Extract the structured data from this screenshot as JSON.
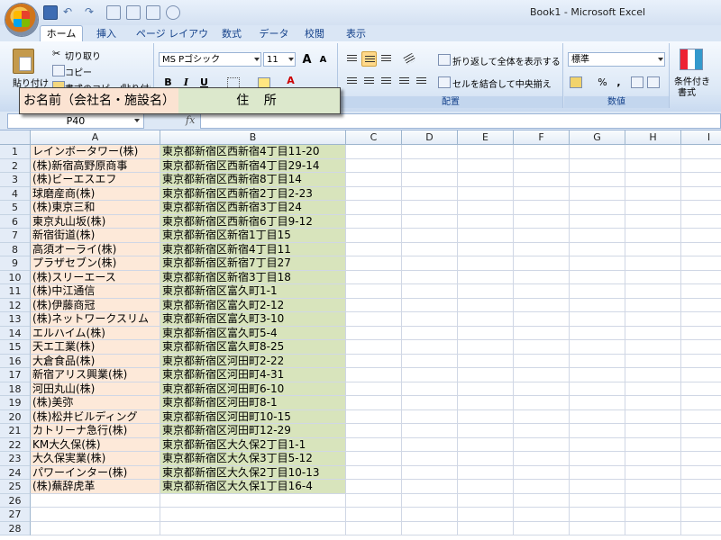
{
  "window": {
    "title": "Book1 - Microsoft Excel"
  },
  "tabs": [
    {
      "label": "ホーム",
      "active": true
    },
    {
      "label": "挿入"
    },
    {
      "label": "ページ レイアウト"
    },
    {
      "label": "数式"
    },
    {
      "label": "データ"
    },
    {
      "label": "校閲"
    },
    {
      "label": "表示"
    }
  ],
  "ribbon": {
    "clipboard": {
      "paste_label": "貼り付け",
      "cut_label": "切り取り",
      "copy_label": "コピー",
      "format_painter_label": "書式のコピー/貼り付け"
    },
    "font": {
      "font_name": "MS Pゴシック",
      "font_size": "11",
      "grow_label": "A",
      "shrink_label": "A",
      "bold": "B",
      "italic": "I",
      "underline": "U",
      "font_color_label": "A"
    },
    "alignment": {
      "wrap_text_label": "折り返して全体を表示する",
      "merge_label": "セルを結合して中央揃え",
      "group_label": "配置"
    },
    "number": {
      "format": "標準",
      "percent": "%",
      "comma": ",",
      "group_label": "数値"
    },
    "styles": {
      "conditional_label": "条件付き",
      "format_label": "書式"
    }
  },
  "callout": {
    "col_a": "お名前（会社名・施設名）",
    "col_b": "住 所"
  },
  "formula_bar": {
    "name_box": "P40",
    "fx": "fx",
    "value": ""
  },
  "grid": {
    "columns": [
      "A",
      "B",
      "C",
      "D",
      "E",
      "F",
      "G",
      "H",
      "I"
    ],
    "rows": [
      {
        "num": "1",
        "a": "レインボータワー(株)",
        "b": "東京都新宿区西新宿4丁目11-20"
      },
      {
        "num": "2",
        "a": "(株)新宿高野原商事",
        "b": "東京都新宿区西新宿4丁目29-14"
      },
      {
        "num": "3",
        "a": "(株)ビーエスエフ",
        "b": "東京都新宿区西新宿8丁目14"
      },
      {
        "num": "4",
        "a": "球磨産商(株)",
        "b": "東京都新宿区西新宿2丁目2-23"
      },
      {
        "num": "5",
        "a": "(株)東京三和",
        "b": "東京都新宿区西新宿3丁目24"
      },
      {
        "num": "6",
        "a": "東京丸山坂(株)",
        "b": "東京都新宿区西新宿6丁目9-12"
      },
      {
        "num": "7",
        "a": "新宿街道(株)",
        "b": "東京都新宿区新宿1丁目15"
      },
      {
        "num": "8",
        "a": "高須オーライ(株)",
        "b": "東京都新宿区新宿4丁目11"
      },
      {
        "num": "9",
        "a": "プラザセブン(株)",
        "b": "東京都新宿区新宿7丁目27"
      },
      {
        "num": "10",
        "a": "(株)スリーエース",
        "b": "東京都新宿区新宿3丁目18"
      },
      {
        "num": "11",
        "a": "(株)中江通信",
        "b": "東京都新宿区富久町1-1"
      },
      {
        "num": "12",
        "a": "(株)伊藤商冠",
        "b": "東京都新宿区富久町2-12"
      },
      {
        "num": "13",
        "a": "(株)ネットワークスリム",
        "b": "東京都新宿区富久町3-10"
      },
      {
        "num": "14",
        "a": "エルハイム(株)",
        "b": "東京都新宿区富久町5-4"
      },
      {
        "num": "15",
        "a": "天エ工業(株)",
        "b": "東京都新宿区富久町8-25"
      },
      {
        "num": "16",
        "a": "大倉食品(株)",
        "b": "東京都新宿区河田町2-22"
      },
      {
        "num": "17",
        "a": "新宿アリス興業(株)",
        "b": "東京都新宿区河田町4-31"
      },
      {
        "num": "18",
        "a": "河田丸山(株)",
        "b": "東京都新宿区河田町6-10"
      },
      {
        "num": "19",
        "a": "(株)美弥",
        "b": "東京都新宿区河田町8-1"
      },
      {
        "num": "20",
        "a": "(株)松井ビルディング",
        "b": "東京都新宿区河田町10-15"
      },
      {
        "num": "21",
        "a": "カトリーナ急行(株)",
        "b": "東京都新宿区河田町12-29"
      },
      {
        "num": "22",
        "a": "KM大久保(株)",
        "b": "東京都新宿区大久保2丁目1-1"
      },
      {
        "num": "23",
        "a": "大久保実業(株)",
        "b": "東京都新宿区大久保3丁目5-12"
      },
      {
        "num": "24",
        "a": "パワーインター(株)",
        "b": "東京都新宿区大久保2丁目10-13"
      },
      {
        "num": "25",
        "a": "(株)蕪辞虎革",
        "b": "東京都新宿区大久保1丁目16-4"
      },
      {
        "num": "26",
        "a": "",
        "b": ""
      },
      {
        "num": "27",
        "a": "",
        "b": ""
      },
      {
        "num": "28",
        "a": "",
        "b": ""
      }
    ]
  },
  "colors": {
    "col_a_fill": "#fde9d9",
    "col_b_fill": "#d8e4bc",
    "ribbon_accent": "#15428b"
  },
  "icons": [
    "office-button-icon",
    "save-icon",
    "undo-icon",
    "redo-icon",
    "paste-icon",
    "scissors-icon",
    "copy-icon",
    "brush-icon",
    "borders-icon",
    "fill-color-icon",
    "wrap-text-icon",
    "merge-icon",
    "currency-icon",
    "conditional-format-icon",
    "fx-icon"
  ]
}
